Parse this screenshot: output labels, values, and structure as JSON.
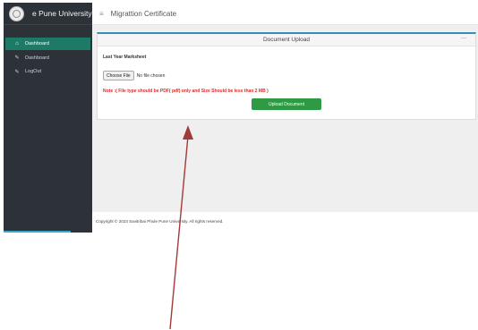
{
  "sidebar": {
    "brand": "e Pune University",
    "items": [
      {
        "label": "Dashboard",
        "icon": "home-icon",
        "active": true
      },
      {
        "label": "Dashboard",
        "icon": "edit-icon",
        "active": false
      },
      {
        "label": "LogOut",
        "icon": "edit-icon",
        "active": false
      }
    ]
  },
  "header": {
    "title": "Migrattion Certificate"
  },
  "card": {
    "title": "Document Upload",
    "field_label": "Last Year Marksheet",
    "choose_file_label": "Choose File",
    "no_file_text": "No file chosen",
    "note": "Note :( File type should be PDF( pdf) only and Size Should be less than 2 MB )",
    "upload_button": "Upload Document"
  },
  "footer": {
    "text": "Copyright © 2023 Savitribai Phule Pune University. All rights reserved."
  },
  "colors": {
    "sidebar_bg": "#2d3238",
    "active_item": "#1c7a67",
    "upload_button": "#2e9a43",
    "note_text": "#e02b27",
    "card_accent": "#3a8bb8",
    "annotation_arrow": "#a33a3a"
  }
}
